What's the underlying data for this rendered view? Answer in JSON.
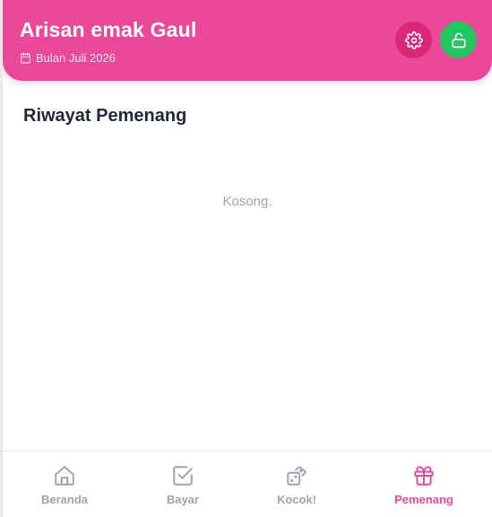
{
  "header": {
    "title": "Arisan emak Gaul",
    "month_label": "Bulan Juli 2026",
    "calendar_icon": "calendar-icon",
    "settings_icon": "gear-icon",
    "lock_icon": "unlock-icon"
  },
  "main": {
    "section_title": "Riwayat Pemenang",
    "empty_message": "Kosong."
  },
  "bottom_nav": {
    "items": [
      {
        "label": "Beranda",
        "icon": "home-icon",
        "active": false
      },
      {
        "label": "Bayar",
        "icon": "check-square-icon",
        "active": false
      },
      {
        "label": "Kocok!",
        "icon": "dice-icon",
        "active": false
      },
      {
        "label": "Pemenang",
        "icon": "gift-icon",
        "active": true
      }
    ]
  },
  "colors": {
    "brand_pink": "#ec4899",
    "settings_button": "#db2777",
    "lock_button": "#22c55e",
    "text_dark": "#1f2937",
    "text_muted": "#9ca3af"
  }
}
